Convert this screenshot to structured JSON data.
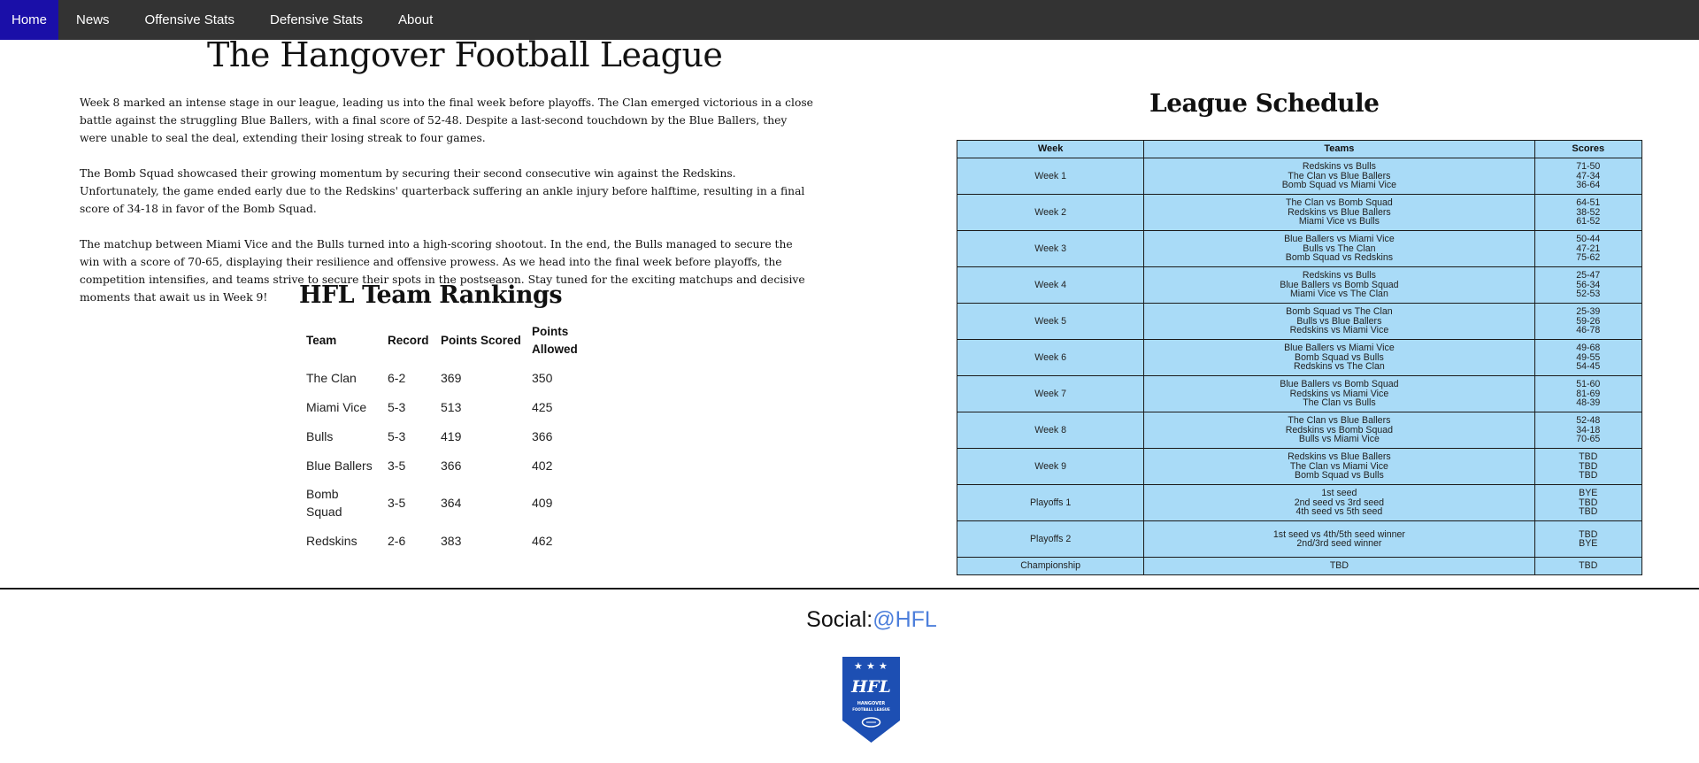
{
  "nav": {
    "items": [
      {
        "label": "Home",
        "active": true
      },
      {
        "label": "News",
        "active": false
      },
      {
        "label": "Offensive Stats",
        "active": false
      },
      {
        "label": "Defensive Stats",
        "active": false
      },
      {
        "label": "About",
        "active": false
      }
    ]
  },
  "page": {
    "title": "The Hangover Football League"
  },
  "article": {
    "paragraphs": [
      "Week 8 marked an intense stage in our league, leading us into the final week before playoffs. The Clan emerged victorious in a close battle against the struggling Blue Ballers, with a final score of 52-48. Despite a last-second touchdown by the Blue Ballers, they were unable to seal the deal, extending their losing streak to four games.",
      "The Bomb Squad showcased their growing momentum by securing their second consecutive win against the Redskins. Unfortunately, the game ended early due to the Redskins' quarterback suffering an ankle injury before halftime, resulting in a final score of 34-18 in favor of the Bomb Squad.",
      "The matchup between Miami Vice and the Bulls turned into a high-scoring shootout. In the end, the Bulls managed to secure the win with a score of 70-65, displaying their resilience and offensive prowess. As we head into the final week before playoffs, the competition intensifies, and teams strive to secure their spots in the postseason. Stay tuned for the exciting matchups and decisive moments that await us in Week 9!"
    ]
  },
  "rankings": {
    "title": "HFL Team Rankings",
    "headers": [
      "Team",
      "Record",
      "Points Scored",
      "Points Allowed"
    ],
    "rows": [
      [
        "The Clan",
        "6-2",
        "369",
        "350"
      ],
      [
        "Miami Vice",
        "5-3",
        "513",
        "425"
      ],
      [
        "Bulls",
        "5-3",
        "419",
        "366"
      ],
      [
        "Blue Ballers",
        "3-5",
        "366",
        "402"
      ],
      [
        "Bomb Squad",
        "3-5",
        "364",
        "409"
      ],
      [
        "Redskins",
        "2-6",
        "383",
        "462"
      ]
    ]
  },
  "schedule": {
    "title": "League Schedule",
    "headers": [
      "Week",
      "Teams",
      "Scores"
    ],
    "rows": [
      {
        "week": "Week 1",
        "teams": [
          "Redskins vs Bulls",
          "The Clan vs Blue Ballers",
          "Bomb Squad vs Miami Vice"
        ],
        "scores": [
          "71-50",
          "47-34",
          "36-64"
        ]
      },
      {
        "week": "Week 2",
        "teams": [
          "The Clan vs Bomb Squad",
          "Redskins vs Blue Ballers",
          "Miami Vice vs Bulls"
        ],
        "scores": [
          "64-51",
          "38-52",
          "61-52"
        ]
      },
      {
        "week": "Week 3",
        "teams": [
          "Blue Ballers vs Miami Vice",
          "Bulls vs The Clan",
          "Bomb Squad vs Redskins"
        ],
        "scores": [
          "50-44",
          "47-21",
          "75-62"
        ]
      },
      {
        "week": "Week 4",
        "teams": [
          "Redskins vs Bulls",
          "Blue Ballers vs Bomb Squad",
          "Miami Vice vs The Clan"
        ],
        "scores": [
          "25-47",
          "56-34",
          "52-53"
        ]
      },
      {
        "week": "Week 5",
        "teams": [
          "Bomb Squad vs The Clan",
          "Bulls vs Blue Ballers",
          "Redskins vs Miami Vice"
        ],
        "scores": [
          "25-39",
          "59-26",
          "46-78"
        ]
      },
      {
        "week": "Week 6",
        "teams": [
          "Blue Ballers vs Miami Vice",
          "Bomb Squad vs Bulls",
          "Redskins vs The Clan"
        ],
        "scores": [
          "49-68",
          "49-55",
          "54-45"
        ]
      },
      {
        "week": "Week 7",
        "teams": [
          "Blue Ballers vs Bomb Squad",
          "Redskins vs Miami Vice",
          "The Clan vs Bulls"
        ],
        "scores": [
          "51-60",
          "81-69",
          "48-39"
        ]
      },
      {
        "week": "Week 8",
        "teams": [
          "The Clan vs Blue Ballers",
          "Redskins vs Bomb Squad",
          "Bulls vs Miami Vice"
        ],
        "scores": [
          "52-48",
          "34-18",
          "70-65"
        ]
      },
      {
        "week": "Week 9",
        "teams": [
          "Redskins vs Blue Ballers",
          "The Clan vs Miami Vice",
          "Bomb Squad vs Bulls"
        ],
        "scores": [
          "TBD",
          "TBD",
          "TBD"
        ]
      },
      {
        "week": "Playoffs 1",
        "teams": [
          "1st seed",
          "2nd seed vs 3rd seed",
          "4th seed vs 5th seed"
        ],
        "scores": [
          "BYE",
          "TBD",
          "TBD"
        ]
      },
      {
        "week": "Playoffs 2",
        "teams": [
          "1st seed vs 4th/5th seed winner",
          "2nd/3rd seed winner"
        ],
        "scores": [
          "TBD",
          "BYE"
        ]
      },
      {
        "week": "Championship",
        "teams": [
          "TBD"
        ],
        "scores": [
          "TBD"
        ]
      }
    ]
  },
  "footer": {
    "social_label": "Social:",
    "social_handle": "@HFL",
    "logo": {
      "initials": "HFL",
      "name_line1": "HANGOVER",
      "name_line2": "FOOTBALL LEAGUE",
      "color": "#1d4fb3"
    }
  }
}
